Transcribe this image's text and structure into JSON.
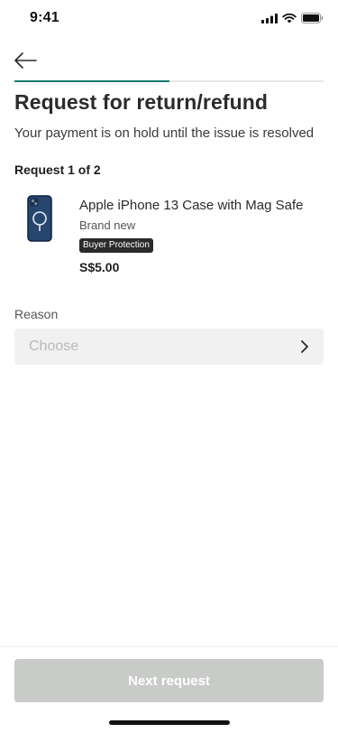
{
  "status_bar": {
    "time": "9:41"
  },
  "header": {
    "back_icon": "arrow-left-icon"
  },
  "progress": {
    "current_step": 1,
    "total_steps": 2,
    "fill_fraction": 0.5,
    "fill_color": "#0f7a6b"
  },
  "page": {
    "title": "Request for return/refund",
    "subtitle": "Your payment is on hold until the issue is resolved",
    "request_count": "Request 1 of 2"
  },
  "item": {
    "name": "Apple iPhone  13 Case with Mag Safe",
    "condition": "Brand new",
    "badge": "Buyer Protection",
    "price": "S$5.00"
  },
  "reason": {
    "label": "Reason",
    "placeholder": "Choose",
    "chevron_icon": "chevron-right-icon"
  },
  "footer": {
    "next_label": "Next request"
  },
  "colors": {
    "accent": "#0f7a6b",
    "disabled_button": "#c9cbc9",
    "select_bg": "#f0f1f0"
  }
}
